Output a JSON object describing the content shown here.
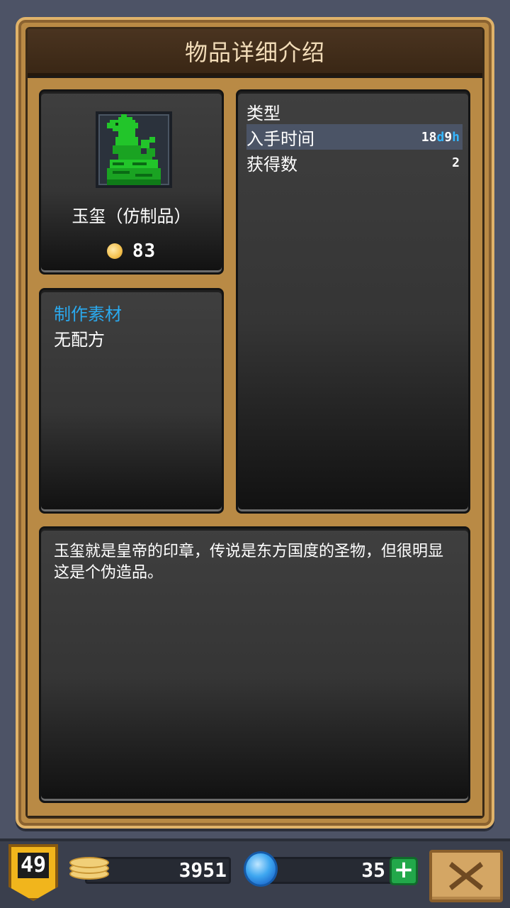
{
  "dialog": {
    "title": "物品详细介绍"
  },
  "item": {
    "name": "玉玺（仿制品）",
    "icon": "jade-seal-icon",
    "price": "83",
    "icon_color": "#22c52a"
  },
  "info": {
    "rows": [
      {
        "label": "类型",
        "value": ""
      },
      {
        "label": "入手时间",
        "value_num1": "18",
        "value_unit1": "d",
        "value_num2": "9",
        "value_unit2": "h"
      },
      {
        "label": "获得数",
        "value": "2"
      }
    ]
  },
  "craft": {
    "title": "制作素材",
    "text": "无配方"
  },
  "description": {
    "text": "玉玺就是皇帝的印章，传说是东方国度的圣物，但很明显这是个伪造品。"
  },
  "footer": {
    "level": "49",
    "gold": "3951",
    "gems": "35",
    "gold_icon": "gold-coins-icon",
    "gem_icon": "blue-gem-icon",
    "add_icon": "plus-icon",
    "close_icon": "close-icon"
  },
  "colors": {
    "accent_blue": "#2aa9ee",
    "frame_gold": "#b98a45"
  }
}
